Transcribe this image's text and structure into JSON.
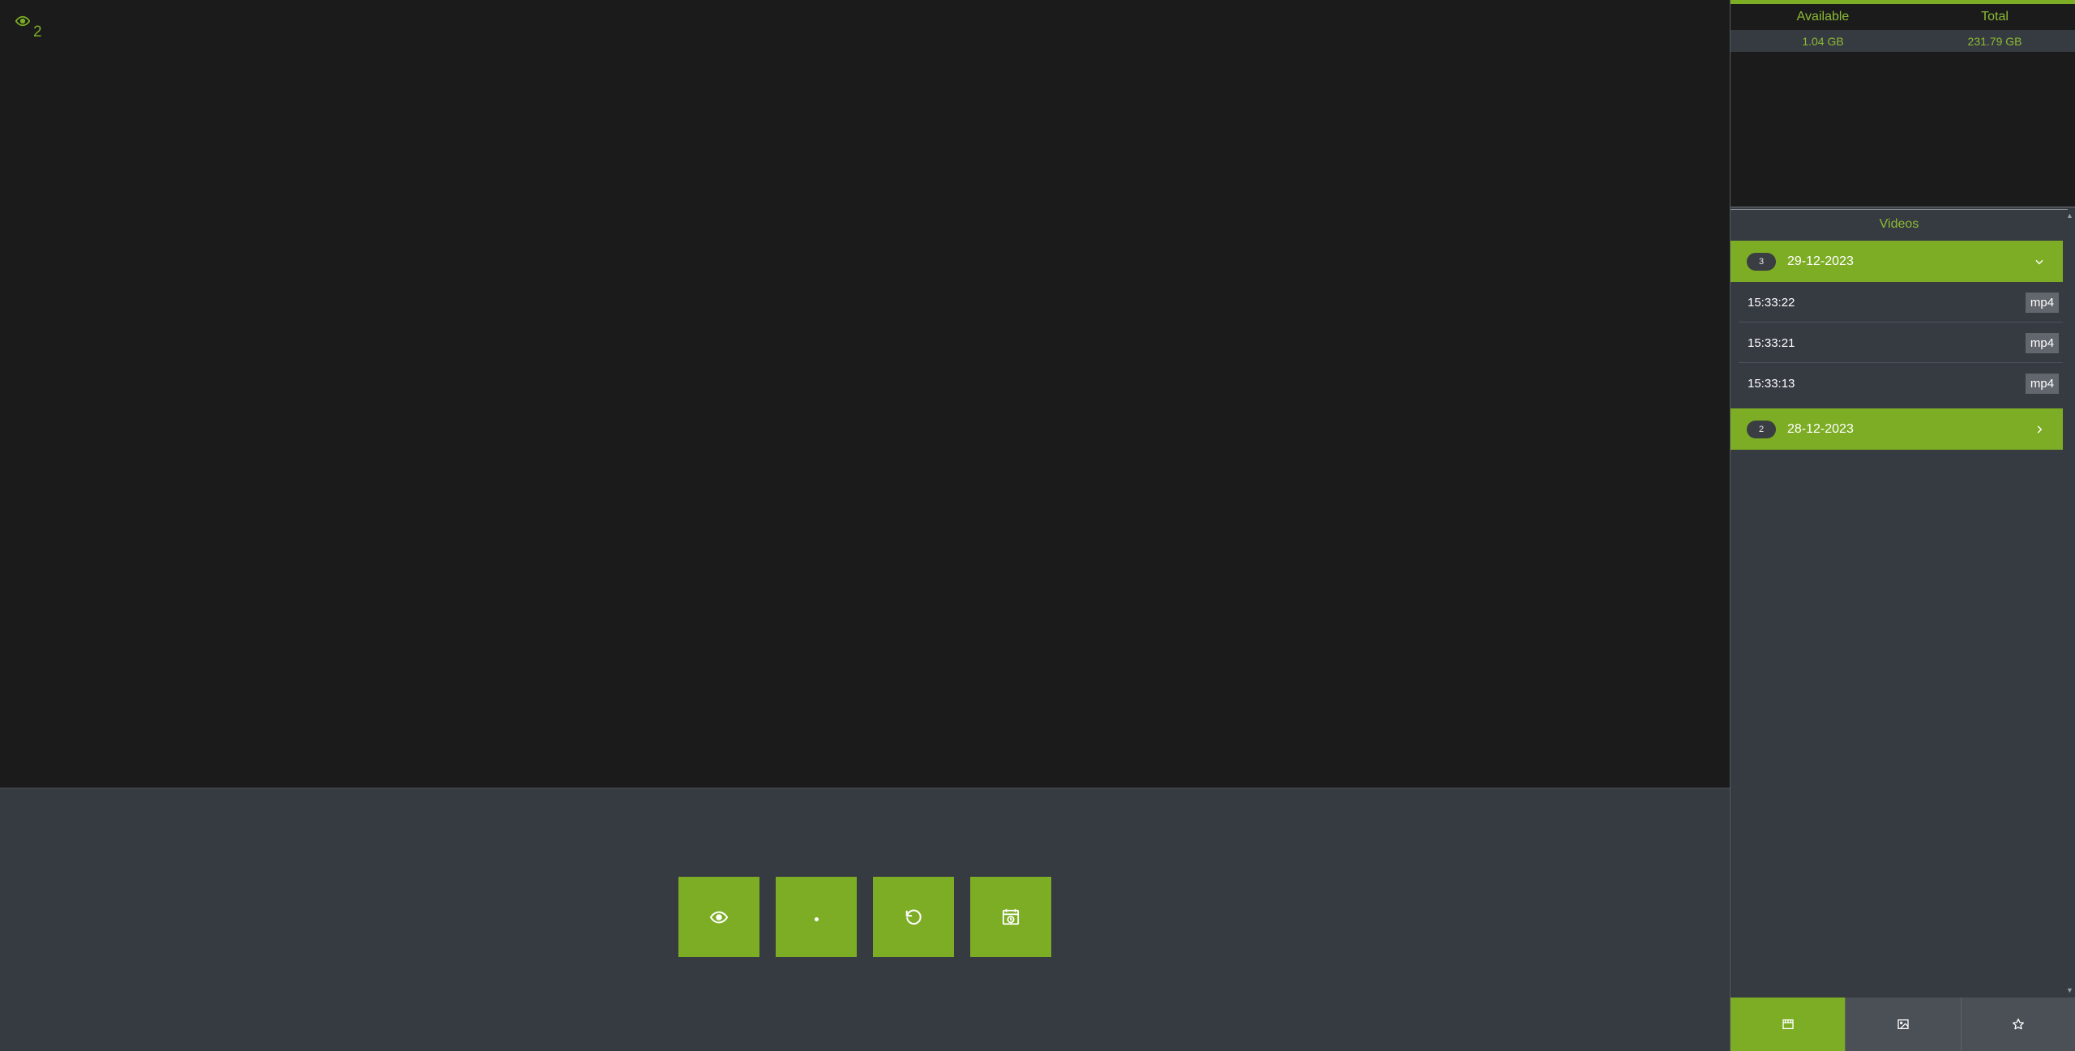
{
  "viewer": {
    "count": "2",
    "icon": "eye-icon"
  },
  "controls": [
    {
      "name": "view-button",
      "icon": "eye-icon"
    },
    {
      "name": "record-button",
      "icon": "dot-icon"
    },
    {
      "name": "refresh-button",
      "icon": "rotate-left-icon"
    },
    {
      "name": "schedule-button",
      "icon": "calendar-clock-icon"
    }
  ],
  "storage": {
    "headers": {
      "available": "Available",
      "total": "Total"
    },
    "values": {
      "available": "1.04 GB",
      "total": "231.79 GB"
    }
  },
  "videos": {
    "title": "Videos",
    "groups": [
      {
        "count": "3",
        "date": "29-12-2023",
        "expanded": true,
        "items": [
          {
            "time": "15:33:22",
            "format": "mp4"
          },
          {
            "time": "15:33:21",
            "format": "mp4"
          },
          {
            "time": "15:33:13",
            "format": "mp4"
          }
        ]
      },
      {
        "count": "2",
        "date": "28-12-2023",
        "expanded": false,
        "items": []
      }
    ]
  },
  "tabs": [
    {
      "name": "videos-tab",
      "icon": "film-icon",
      "active": true
    },
    {
      "name": "photos-tab",
      "icon": "image-icon",
      "active": false
    },
    {
      "name": "favorites-tab",
      "icon": "star-icon",
      "active": false
    }
  ],
  "colors": {
    "accent": "#7cad25",
    "background": "#1b1b1c",
    "panel": "#363a41"
  }
}
